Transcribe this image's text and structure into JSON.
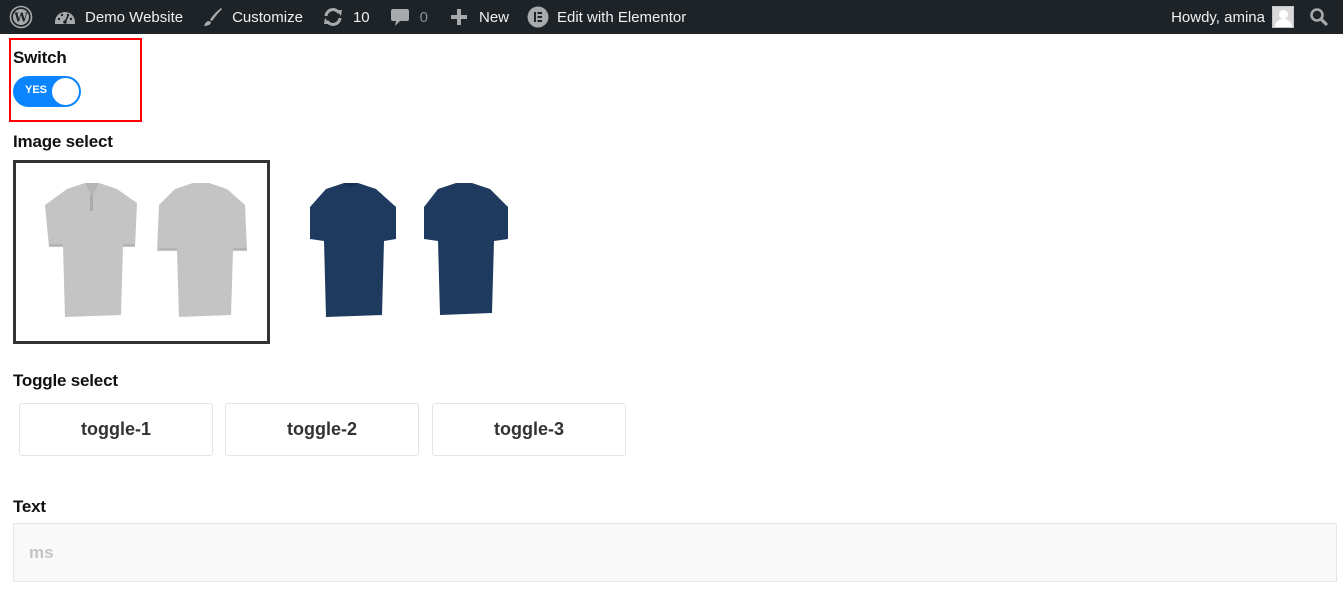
{
  "adminbar": {
    "wp_logo_icon": "wordpress-icon",
    "site": {
      "icon": "dashboard-icon",
      "label": "Demo Website"
    },
    "customize": {
      "icon": "paintbrush-icon",
      "label": "Customize"
    },
    "updates": {
      "icon": "refresh-icon",
      "count": "10"
    },
    "comments": {
      "icon": "comment-icon",
      "count": "0"
    },
    "new": {
      "icon": "plus-icon",
      "label": "New"
    },
    "elementor": {
      "icon": "elementor-icon",
      "label": "Edit with Elementor"
    },
    "howdy": "Howdy, amina",
    "avatar_icon": "user-avatar-icon",
    "search_icon": "search-icon"
  },
  "form": {
    "switch": {
      "label": "Switch",
      "state_text": "YES",
      "on": true,
      "highlight_color": "#ff0000",
      "on_color": "#0a84ff"
    },
    "image_select": {
      "label": "Image select",
      "options": [
        {
          "name": "grey polo shirt (front and back)",
          "color": "#c4c4c4",
          "selected": true
        },
        {
          "name": "navy t-shirt (front and back)",
          "color": "#1f3a5f",
          "selected": false
        }
      ]
    },
    "toggle_select": {
      "label": "Toggle select",
      "options": [
        "toggle-1",
        "toggle-2",
        "toggle-3"
      ]
    },
    "text": {
      "label": "Text",
      "value": "ms"
    }
  }
}
